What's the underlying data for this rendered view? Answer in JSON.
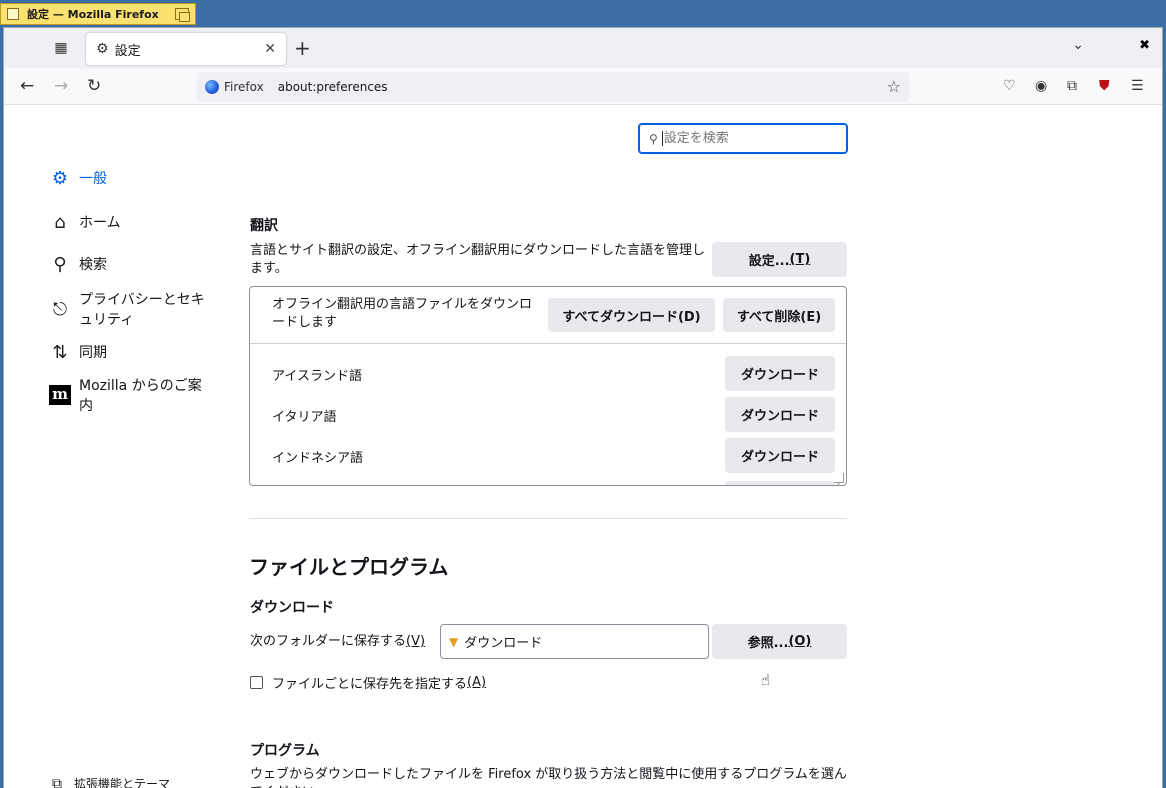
{
  "window": {
    "title": "設定 — Mozilla Firefox"
  },
  "tabs": [
    {
      "label": "設定"
    }
  ],
  "navbar": {
    "brand": "Firefox",
    "url": "about:preferences"
  },
  "search": {
    "placeholder": "設定を検索"
  },
  "sidebar": {
    "items": [
      {
        "label": "一般",
        "icon": "gear-icon",
        "active": true
      },
      {
        "label": "ホーム",
        "icon": "home-icon"
      },
      {
        "label": "検索",
        "icon": "search-icon"
      },
      {
        "label": "プライバシーとセキュリティ",
        "icon": "lock-icon"
      },
      {
        "label": "同期",
        "icon": "sync-icon"
      },
      {
        "label": "Mozilla からのご案内",
        "icon": "mozilla-icon"
      }
    ],
    "bottom": [
      {
        "label": "拡張機能とテーマ",
        "icon": "puzzle-icon"
      }
    ]
  },
  "translation": {
    "heading": "翻訳",
    "description": "言語とサイト翻訳の設定、オフライン翻訳用にダウンロードした言語を管理します。",
    "settings_button": "設定...",
    "settings_key": "(T)",
    "offline_description": "オフライン翻訳用の言語ファイルをダウンロードします",
    "download_all_button": "すべてダウンロード(D)",
    "delete_all_button": "すべて削除(E)",
    "languages": [
      {
        "name": "アイスランド語",
        "button": "ダウンロード"
      },
      {
        "name": "イタリア語",
        "button": "ダウンロード"
      },
      {
        "name": "インドネシア語",
        "button": "ダウンロード"
      }
    ]
  },
  "files": {
    "heading": "ファイルとプログラム",
    "downloads_heading": "ダウンロード",
    "save_to_label": "次のフォルダーに保存する",
    "save_to_key": "(V)",
    "folder_value": "ダウンロード",
    "browse_button": "参照...",
    "browse_key": "(O)",
    "ask_label": "ファイルごとに保存先を指定する",
    "ask_key": "(A)",
    "ask_checked": false
  },
  "programs": {
    "heading": "プログラム",
    "description": "ウェブからダウンロードしたファイルを Firefox が取り扱う方法と閲覧中に使用するプログラムを選んでください。"
  },
  "colors": {
    "accent": "#0061e0",
    "button_bg": "#e9e9ed"
  }
}
